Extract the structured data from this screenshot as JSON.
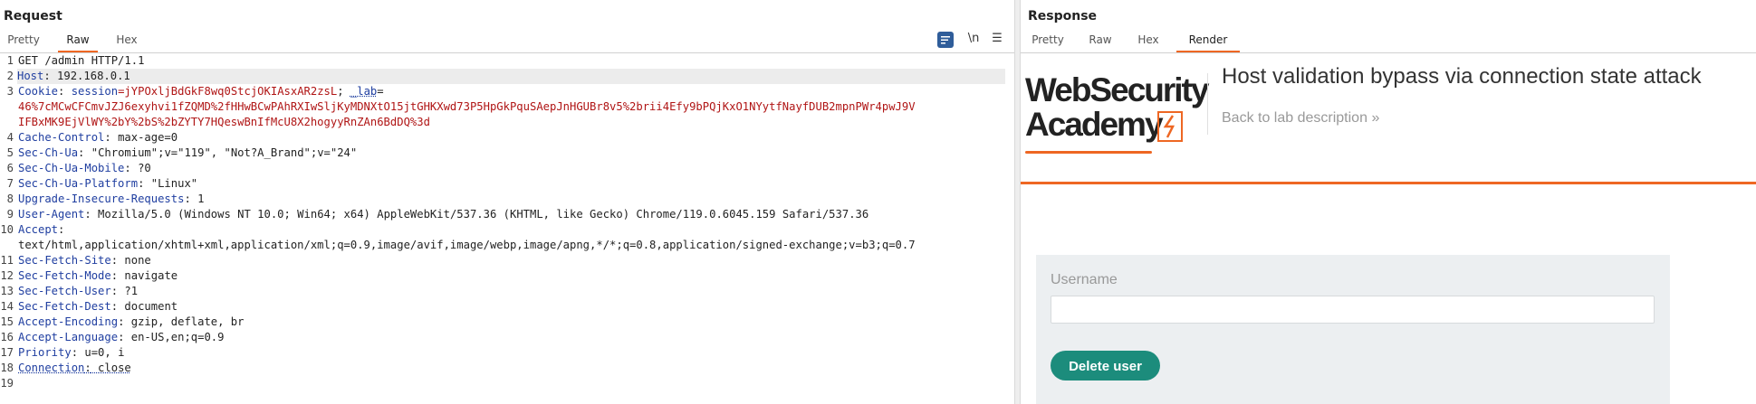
{
  "request": {
    "title": "Request",
    "tabs": [
      "Pretty",
      "Raw",
      "Hex"
    ],
    "active_tab": "Raw",
    "newline_toggle": "\\n",
    "menu_icon": "☰",
    "line_numbers": [
      "1",
      "2",
      "3",
      "4",
      "5",
      "6",
      "7",
      "8",
      "9",
      "10",
      "11",
      "12",
      "13",
      "14",
      "15",
      "16",
      "17",
      "18",
      "19"
    ],
    "lines": {
      "l1": "GET /admin HTTP/1.1",
      "l2_key": "Host",
      "l2_val": " 192.168.0.1",
      "l3_key": "Cookie",
      "l3_sep": ": ",
      "l3_cname": "session",
      "l3_cval": "=jYPOxljBdGkF8wq0StcjOKIAsxAR2zsL",
      "l3_sep2": "; ",
      "l3_lab": "_lab",
      "l3_eq": "=",
      "l3_cont1": "46%7cMCwCFCmvJZJ6exyhvi1fZQMD%2fHHwBCwPAhRXIwSljKyMDNXtO15jtGHKXwd73P5HpGkPquSAepJnHGUBr8v5%2brii4Efy9bPQjKxO1NYytfNayfDUB2mpnPWr4pwJ9V",
      "l3_cont2": "IFBxMK9EjVlWY%2bY%2bS%2bZYTY7HQeswBnIfMcU8X2hogyyRnZAn6BdDQ%3d",
      "l4_key": "Cache-Control",
      "l4_val": " max-age=0",
      "l5_key": "Sec-Ch-Ua",
      "l5_val": " \"Chromium\";v=\"119\", \"Not?A_Brand\";v=\"24\"",
      "l6_key": "Sec-Ch-Ua-Mobile",
      "l6_val": " ?0",
      "l7_key": "Sec-Ch-Ua-Platform",
      "l7_val": " \"Linux\"",
      "l8_key": "Upgrade-Insecure-Requests",
      "l8_val": " 1",
      "l9_key": "User-Agent",
      "l9_val": " Mozilla/5.0 (Windows NT 10.0; Win64; x64) AppleWebKit/537.36 (KHTML, like Gecko) Chrome/119.0.6045.159 Safari/537.36",
      "l10_key": "Accept",
      "l10_cont": "text/html,application/xhtml+xml,application/xml;q=0.9,image/avif,image/webp,image/apng,*/*;q=0.8,application/signed-exchange;v=b3;q=0.7",
      "l11_key": "Sec-Fetch-Site",
      "l11_val": " none",
      "l12_key": "Sec-Fetch-Mode",
      "l12_val": " navigate",
      "l13_key": "Sec-Fetch-User",
      "l13_val": " ?1",
      "l14_key": "Sec-Fetch-Dest",
      "l14_val": " document",
      "l15_key": "Accept-Encoding",
      "l15_val": " gzip, deflate, br",
      "l16_key": "Accept-Language",
      "l16_val": " en-US,en;q=0.9",
      "l17_key": "Priority",
      "l17_val": " u=0, i",
      "l18_key": "Connection",
      "l18_val": " close"
    }
  },
  "response": {
    "title": "Response",
    "tabs": [
      "Pretty",
      "Raw",
      "Hex",
      "Render"
    ],
    "active_tab": "Render",
    "logo_line1": "WebSecurity",
    "logo_line2": "Academy",
    "lab_title": "Host validation bypass via connection state attack",
    "back_link": "Back to lab description",
    "back_chevron": "»",
    "form": {
      "username_label": "Username",
      "username_value": "",
      "submit_label": "Delete user"
    }
  },
  "colors": {
    "accent_orange": "#ee6723",
    "header_key_blue": "#1f3ea0",
    "cookie_red": "#b01515",
    "button_teal": "#1c8c7c",
    "form_bg": "#eceff1"
  }
}
